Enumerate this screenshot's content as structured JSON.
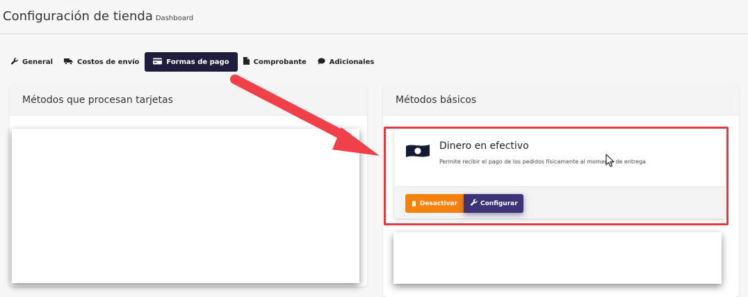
{
  "header": {
    "title": "Configuración de tienda",
    "subtitle": "Dashboard"
  },
  "tabs": [
    {
      "label": "General",
      "icon": "wrench-icon",
      "active": false
    },
    {
      "label": "Costos de envío",
      "icon": "truck-icon",
      "active": false
    },
    {
      "label": "Formas de pago",
      "icon": "credit-card-icon",
      "active": true
    },
    {
      "label": "Comprobante",
      "icon": "file-icon",
      "active": false
    },
    {
      "label": "Adicionales",
      "icon": "comment-icon",
      "active": false
    }
  ],
  "left_panel": {
    "title": "Métodos que procesan tarjetas"
  },
  "right_panel": {
    "title": "Métodos básicos",
    "method": {
      "title": "Dinero en efectivo",
      "description": "Permite recibir el pago de los pedidos físicamente al momento de entrega",
      "icon": "money-bill-icon",
      "deactivate_label": "Desactivar",
      "configure_label": "Configurar"
    }
  },
  "colors": {
    "active_tab": "#1f1d3d",
    "deactivate_button": "#f7830d",
    "configure_button": "#3b3578",
    "annotation": "#e03a3e"
  }
}
